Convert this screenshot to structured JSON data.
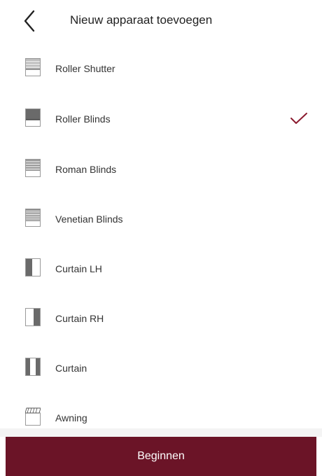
{
  "header": {
    "title": "Nieuw apparaat toevoegen",
    "back_icon": "chevron-left-icon"
  },
  "device_list": {
    "items": [
      {
        "label": "Roller Shutter",
        "icon": "roller-shutter-icon",
        "selected": false
      },
      {
        "label": "Roller Blinds",
        "icon": "roller-blinds-icon",
        "selected": true
      },
      {
        "label": "Roman Blinds",
        "icon": "roman-blinds-icon",
        "selected": false
      },
      {
        "label": "Venetian Blinds",
        "icon": "venetian-blinds-icon",
        "selected": false
      },
      {
        "label": "Curtain LH",
        "icon": "curtain-lh-icon",
        "selected": false
      },
      {
        "label": "Curtain RH",
        "icon": "curtain-rh-icon",
        "selected": false
      },
      {
        "label": "Curtain",
        "icon": "curtain-icon",
        "selected": false
      },
      {
        "label": "Awning",
        "icon": "awning-icon",
        "selected": false
      }
    ]
  },
  "footer": {
    "begin_label": "Beginnen"
  },
  "colors": {
    "accent": "#6b1427",
    "check": "#8b1a2e",
    "icon_dark": "#6a6a6a",
    "icon_light": "#bdbdbd"
  }
}
